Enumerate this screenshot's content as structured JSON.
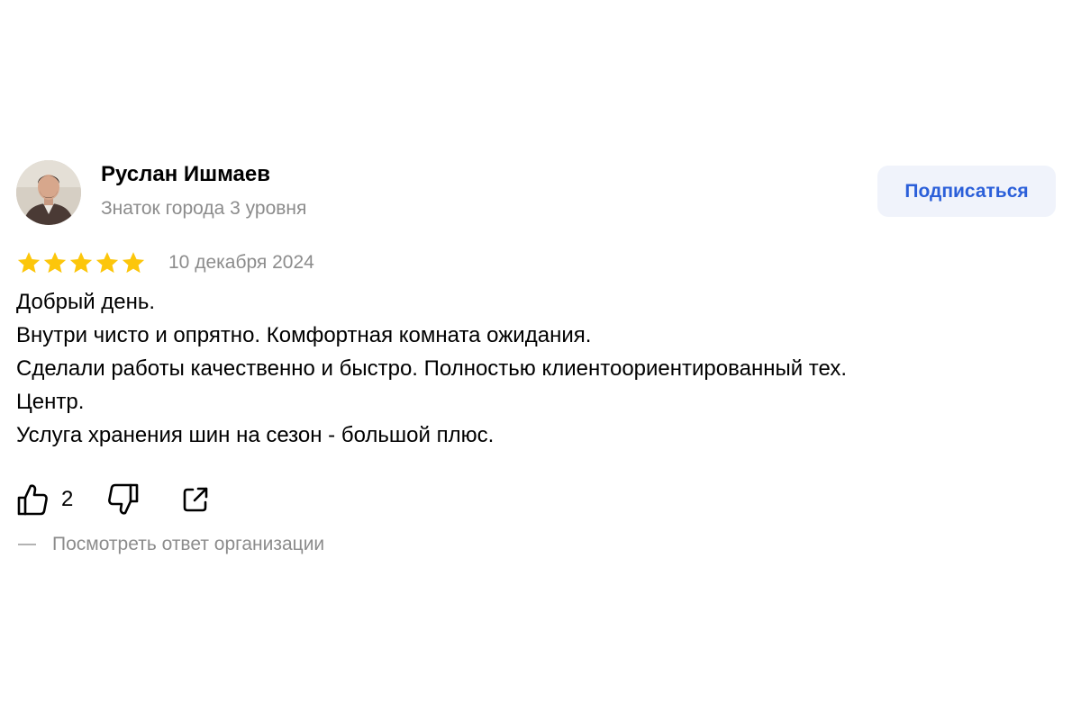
{
  "author": {
    "name": "Руслан Ишмаев",
    "level": "Знаток города 3 уровня"
  },
  "subscribe": {
    "label": "Подписаться"
  },
  "review": {
    "rating": 5,
    "rating_max": 5,
    "date": "10 декабря 2024",
    "lines": [
      "Добрый день.",
      "Внутри чисто и опрятно. Комфортная комната ожидания.",
      "Сделали работы качественно и быстро. Полностью клиентоориентированный тех.",
      "Центр.",
      "Услуга хранения шин на сезон - большой плюс."
    ]
  },
  "actions": {
    "like_icon": "thumbs-up-icon",
    "like_count": "2",
    "dislike_icon": "thumbs-down-icon",
    "share_icon": "share-icon"
  },
  "org_response": {
    "label": "Посмотреть ответ организации"
  },
  "colors": {
    "star": "#fcc60b",
    "accent": "#2b5fd9",
    "button_bg": "#f0f3fb",
    "muted_text": "#8c8c8c"
  }
}
